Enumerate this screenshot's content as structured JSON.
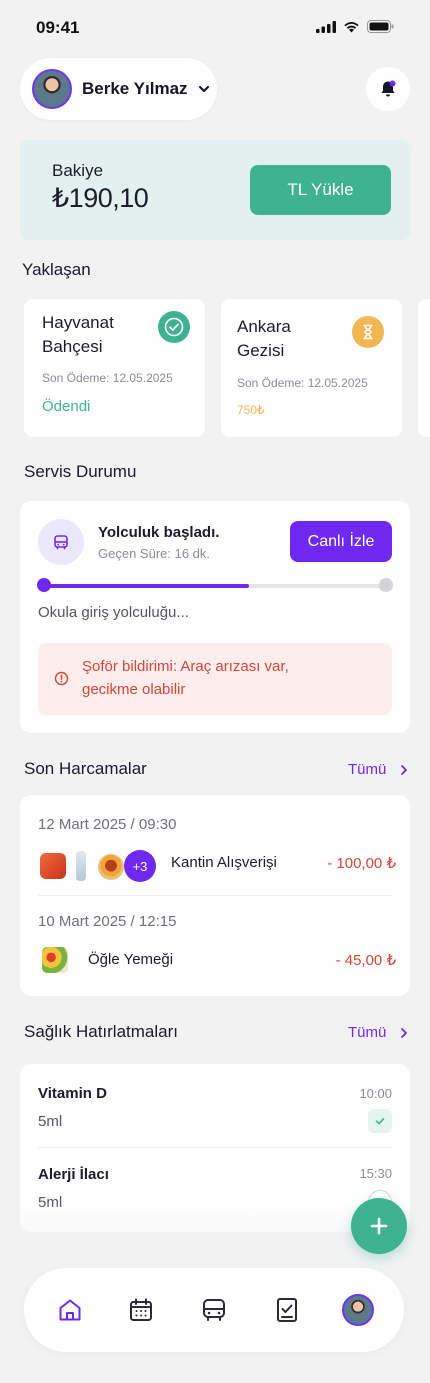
{
  "status_bar": {
    "time": "09:41"
  },
  "header": {
    "user_name": "Berke Yılmaz"
  },
  "balance": {
    "label": "Bakiye",
    "value": "₺190,10",
    "topup_label": "TL Yükle"
  },
  "upcoming": {
    "title": "Yaklaşan",
    "items": [
      {
        "title_line1": "Hayvanat",
        "title_line2": "Bahçesi",
        "due": "Son Ödeme: 12.05.2025",
        "status": "Ödendi",
        "status_color": "#3fb391"
      },
      {
        "title_line1": "Ankara",
        "title_line2": "Gezisi",
        "due": "Son Ödeme: 12.05.2025",
        "status": "750₺",
        "status_color": "#f2b653"
      }
    ]
  },
  "service": {
    "title": "Servis Durumu",
    "trip_status": "Yolculuk başladı.",
    "elapsed": "Geçen Süre: 16 dk.",
    "live_label": "Canlı İzle",
    "progress_percent": 60,
    "route_text": "Okula giriş yolculuğu...",
    "alert_line1": "Şoför bildirimi: Araç arızası var,",
    "alert_line2": "gecikme olabilir"
  },
  "spending": {
    "title": "Son Harcamalar",
    "see_all": "Tümü",
    "items": [
      {
        "datetime": "12 Mart 2025 / 09:30",
        "more_count": "+3",
        "name": "Kantin Alışverişi",
        "amount": "- 100,00 ₺"
      },
      {
        "datetime": "10 Mart 2025 / 12:15",
        "name": "Öğle Yemeği",
        "amount": "- 45,00 ₺"
      }
    ]
  },
  "health": {
    "title": "Sağlık Hatırlatmaları",
    "see_all": "Tümü",
    "items": [
      {
        "name": "Vitamin D",
        "dose": "5ml",
        "time": "10:00"
      },
      {
        "name": "Alerji İlacı",
        "dose": "5ml",
        "time": "15:30"
      }
    ]
  },
  "colors": {
    "accent": "#6f28f0",
    "green": "#3fb391",
    "orange": "#f2b653",
    "danger": "#d4443a"
  },
  "icons": [
    "home-icon",
    "calendar-icon",
    "bus-icon",
    "checklist-icon",
    "profile-avatar"
  ]
}
